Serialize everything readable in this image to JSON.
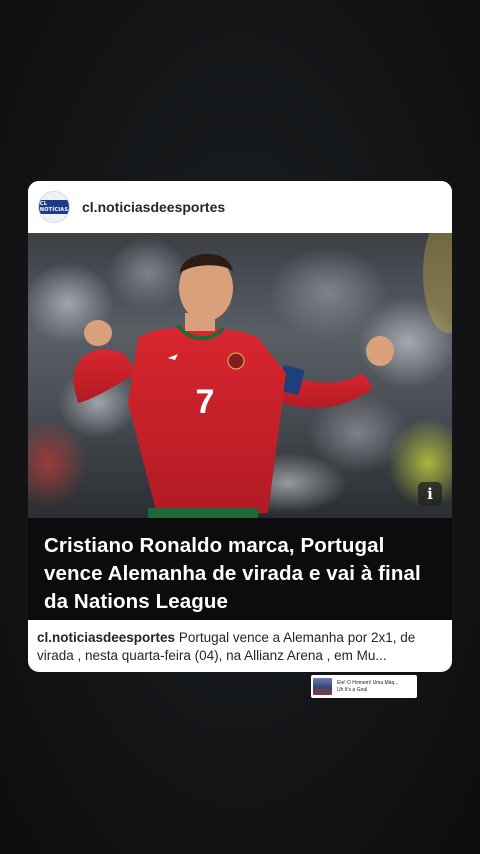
{
  "post": {
    "username": "cl.noticiasdeesportes",
    "avatar_text": "CL NOTÍCIAS",
    "headline": "Cristiano Ronaldo marca, Portugal vence Alemanha de virada e vai à final da Nations League",
    "caption_user": "cl.noticiasdeesportes",
    "caption_text": "Portugal vence a Alemanha por 2x1, de virada , nesta quarta-feira (04), na Allianz Arena , em Mu...",
    "info_icon": "i",
    "jersey_number": "7"
  },
  "music": {
    "title": "Ele! O Homem! Uma Máq...",
    "subtitle": "Uh It's a Goal"
  },
  "colors": {
    "background": "#121416",
    "card": "#ffffff",
    "headline_bg": "#0c0c0d",
    "jersey_red": "#c8202a"
  }
}
